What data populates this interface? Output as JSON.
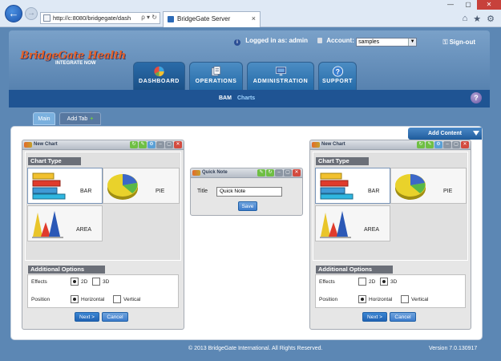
{
  "browser": {
    "address": "http://c:8080/bridgegate/dash",
    "tab_title": "BridgeGate Server",
    "tab_close": "×",
    "back_glyph": "←",
    "forward_glyph": "→",
    "address_tools": "ρ ▾ ↻",
    "window_controls": [
      "—",
      "▢",
      "✕"
    ],
    "tools": [
      "⌂",
      "★",
      "⚙"
    ]
  },
  "header": {
    "logo_main": "BridgeGate Health",
    "logo_sub": "INTEGRATE NOW",
    "logged_in_label": "Logged in as:",
    "user": "admin",
    "account_label": "Account:",
    "account_value": "samples",
    "signout": "Sign-out",
    "colors": {
      "accent": "#1f5493",
      "brand_orange": "#e4622a"
    }
  },
  "main_tabs": [
    {
      "label": "DASHBOARD",
      "icon": "pie-chart-icon",
      "active": true
    },
    {
      "label": "OPERATIONS",
      "icon": "documents-icon",
      "active": false
    },
    {
      "label": "ADMINISTRATION",
      "icon": "monitor-icon",
      "active": false
    },
    {
      "label": "SUPPORT",
      "icon": "question-icon",
      "active": false
    }
  ],
  "sub_nav": {
    "bam": "BAM",
    "charts": "Charts",
    "help": "?"
  },
  "dashboard_tabs": {
    "main": "Main",
    "add": "Add Tab",
    "add_icon": "+"
  },
  "add_content": "Add Content",
  "widgets": {
    "left": {
      "title": "New Chart",
      "chart_type_heading": "Chart Type",
      "bar_label": "BAR",
      "pie_label": "PIE",
      "area_label": "AREA",
      "additional_heading": "Additional Options",
      "effects_label": "Effects",
      "effects_2d": "2D",
      "effects_3d": "3D",
      "effects_selected": "2D",
      "position_label": "Position",
      "position_h": "Horizontal",
      "position_v": "Vertical",
      "position_selected": "Horizontal",
      "next": "Next >",
      "cancel": "Cancel"
    },
    "quick_note": {
      "title": "Quick Note",
      "field_label": "Title",
      "field_value": "Quick Note",
      "save": "Save"
    },
    "right": {
      "title": "New Chart",
      "chart_type_heading": "Chart Type",
      "bar_label": "BAR",
      "pie_label": "PIE",
      "area_label": "AREA",
      "additional_heading": "Additional Options",
      "effects_label": "Effects",
      "effects_2d": "2D",
      "effects_3d": "3D",
      "effects_selected": "3D",
      "position_label": "Position",
      "position_h": "Horizontal",
      "position_v": "Vertical",
      "position_selected": "Horizontal",
      "next": "Next >",
      "cancel": "Cancel"
    }
  },
  "footer": {
    "copyright": "© 2013 BridgeGate International. All Rights Reserved.",
    "version": "Version 7.0.130917"
  }
}
